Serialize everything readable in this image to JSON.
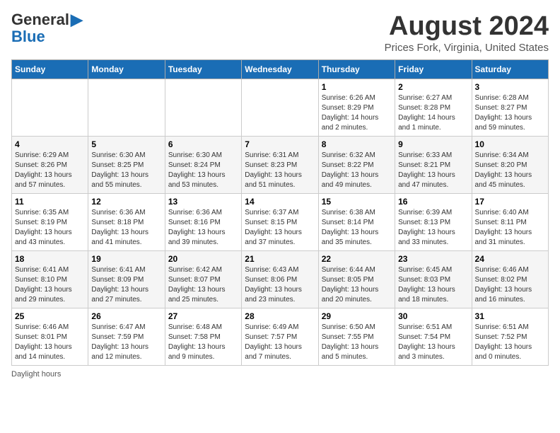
{
  "header": {
    "logo_line1": "General",
    "logo_line2": "Blue",
    "month": "August 2024",
    "location": "Prices Fork, Virginia, United States"
  },
  "days_of_week": [
    "Sunday",
    "Monday",
    "Tuesday",
    "Wednesday",
    "Thursday",
    "Friday",
    "Saturday"
  ],
  "weeks": [
    [
      {
        "day": "",
        "info": ""
      },
      {
        "day": "",
        "info": ""
      },
      {
        "day": "",
        "info": ""
      },
      {
        "day": "",
        "info": ""
      },
      {
        "day": "1",
        "info": "Sunrise: 6:26 AM\nSunset: 8:29 PM\nDaylight: 14 hours\nand 2 minutes."
      },
      {
        "day": "2",
        "info": "Sunrise: 6:27 AM\nSunset: 8:28 PM\nDaylight: 14 hours\nand 1 minute."
      },
      {
        "day": "3",
        "info": "Sunrise: 6:28 AM\nSunset: 8:27 PM\nDaylight: 13 hours\nand 59 minutes."
      }
    ],
    [
      {
        "day": "4",
        "info": "Sunrise: 6:29 AM\nSunset: 8:26 PM\nDaylight: 13 hours\nand 57 minutes."
      },
      {
        "day": "5",
        "info": "Sunrise: 6:30 AM\nSunset: 8:25 PM\nDaylight: 13 hours\nand 55 minutes."
      },
      {
        "day": "6",
        "info": "Sunrise: 6:30 AM\nSunset: 8:24 PM\nDaylight: 13 hours\nand 53 minutes."
      },
      {
        "day": "7",
        "info": "Sunrise: 6:31 AM\nSunset: 8:23 PM\nDaylight: 13 hours\nand 51 minutes."
      },
      {
        "day": "8",
        "info": "Sunrise: 6:32 AM\nSunset: 8:22 PM\nDaylight: 13 hours\nand 49 minutes."
      },
      {
        "day": "9",
        "info": "Sunrise: 6:33 AM\nSunset: 8:21 PM\nDaylight: 13 hours\nand 47 minutes."
      },
      {
        "day": "10",
        "info": "Sunrise: 6:34 AM\nSunset: 8:20 PM\nDaylight: 13 hours\nand 45 minutes."
      }
    ],
    [
      {
        "day": "11",
        "info": "Sunrise: 6:35 AM\nSunset: 8:19 PM\nDaylight: 13 hours\nand 43 minutes."
      },
      {
        "day": "12",
        "info": "Sunrise: 6:36 AM\nSunset: 8:18 PM\nDaylight: 13 hours\nand 41 minutes."
      },
      {
        "day": "13",
        "info": "Sunrise: 6:36 AM\nSunset: 8:16 PM\nDaylight: 13 hours\nand 39 minutes."
      },
      {
        "day": "14",
        "info": "Sunrise: 6:37 AM\nSunset: 8:15 PM\nDaylight: 13 hours\nand 37 minutes."
      },
      {
        "day": "15",
        "info": "Sunrise: 6:38 AM\nSunset: 8:14 PM\nDaylight: 13 hours\nand 35 minutes."
      },
      {
        "day": "16",
        "info": "Sunrise: 6:39 AM\nSunset: 8:13 PM\nDaylight: 13 hours\nand 33 minutes."
      },
      {
        "day": "17",
        "info": "Sunrise: 6:40 AM\nSunset: 8:11 PM\nDaylight: 13 hours\nand 31 minutes."
      }
    ],
    [
      {
        "day": "18",
        "info": "Sunrise: 6:41 AM\nSunset: 8:10 PM\nDaylight: 13 hours\nand 29 minutes."
      },
      {
        "day": "19",
        "info": "Sunrise: 6:41 AM\nSunset: 8:09 PM\nDaylight: 13 hours\nand 27 minutes."
      },
      {
        "day": "20",
        "info": "Sunrise: 6:42 AM\nSunset: 8:07 PM\nDaylight: 13 hours\nand 25 minutes."
      },
      {
        "day": "21",
        "info": "Sunrise: 6:43 AM\nSunset: 8:06 PM\nDaylight: 13 hours\nand 23 minutes."
      },
      {
        "day": "22",
        "info": "Sunrise: 6:44 AM\nSunset: 8:05 PM\nDaylight: 13 hours\nand 20 minutes."
      },
      {
        "day": "23",
        "info": "Sunrise: 6:45 AM\nSunset: 8:03 PM\nDaylight: 13 hours\nand 18 minutes."
      },
      {
        "day": "24",
        "info": "Sunrise: 6:46 AM\nSunset: 8:02 PM\nDaylight: 13 hours\nand 16 minutes."
      }
    ],
    [
      {
        "day": "25",
        "info": "Sunrise: 6:46 AM\nSunset: 8:01 PM\nDaylight: 13 hours\nand 14 minutes."
      },
      {
        "day": "26",
        "info": "Sunrise: 6:47 AM\nSunset: 7:59 PM\nDaylight: 13 hours\nand 12 minutes."
      },
      {
        "day": "27",
        "info": "Sunrise: 6:48 AM\nSunset: 7:58 PM\nDaylight: 13 hours\nand 9 minutes."
      },
      {
        "day": "28",
        "info": "Sunrise: 6:49 AM\nSunset: 7:57 PM\nDaylight: 13 hours\nand 7 minutes."
      },
      {
        "day": "29",
        "info": "Sunrise: 6:50 AM\nSunset: 7:55 PM\nDaylight: 13 hours\nand 5 minutes."
      },
      {
        "day": "30",
        "info": "Sunrise: 6:51 AM\nSunset: 7:54 PM\nDaylight: 13 hours\nand 3 minutes."
      },
      {
        "day": "31",
        "info": "Sunrise: 6:51 AM\nSunset: 7:52 PM\nDaylight: 13 hours\nand 0 minutes."
      }
    ]
  ],
  "footer": {
    "note": "Daylight hours"
  }
}
